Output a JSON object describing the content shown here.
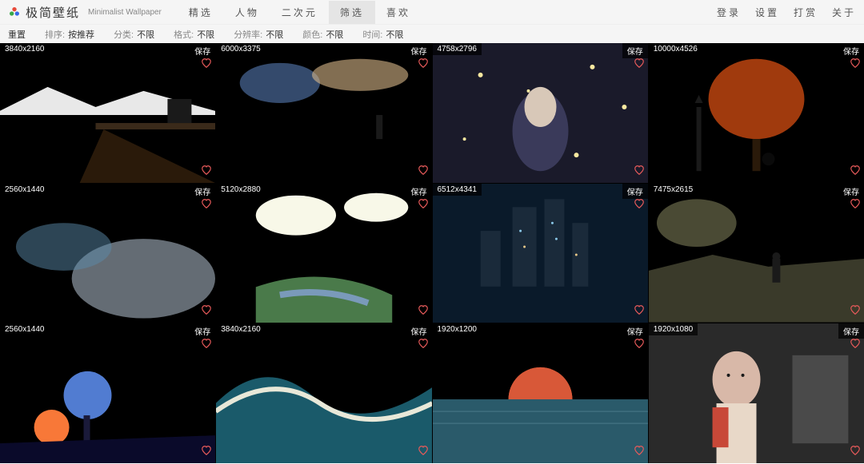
{
  "header": {
    "site_title": "极简壁纸",
    "site_sub": "Minimalist Wallpaper",
    "tabs": [
      {
        "label": "精选"
      },
      {
        "label": "人物"
      },
      {
        "label": "二次元"
      },
      {
        "label": "筛选"
      },
      {
        "label": "喜欢"
      }
    ],
    "active_tab": 3,
    "right_links": [
      {
        "label": "登录"
      },
      {
        "label": "设置"
      },
      {
        "label": "打赏"
      },
      {
        "label": "关于"
      }
    ]
  },
  "filters": [
    {
      "label": "重置",
      "value": ""
    },
    {
      "label": "排序:",
      "value": "按推荐"
    },
    {
      "label": "分类:",
      "value": "不限"
    },
    {
      "label": "格式:",
      "value": "不限"
    },
    {
      "label": "分辨率:",
      "value": "不限"
    },
    {
      "label": "颜色:",
      "value": "不限"
    },
    {
      "label": "时间:",
      "value": "不限"
    }
  ],
  "save_label": "保存",
  "items": [
    {
      "res": "3840x2160"
    },
    {
      "res": "6000x3375"
    },
    {
      "res": "4758x2796"
    },
    {
      "res": "10000x4526"
    },
    {
      "res": "2560x1440"
    },
    {
      "res": "5120x2880"
    },
    {
      "res": "6512x4341"
    },
    {
      "res": "7475x2615"
    },
    {
      "res": "2560x1440"
    },
    {
      "res": "3840x2160"
    },
    {
      "res": "1920x1200"
    },
    {
      "res": "1920x1080"
    }
  ],
  "thumb_svgs": [
    "<svg xmlns='http://www.w3.org/2000/svg' viewBox='0 0 270 175'><defs><linearGradient id='g0' x1='0' y1='0' x2='0' y2='1'><stop offset='0' stop-color='#0a1a3a'/><stop offset='0.45' stop-color='#1a4a7a'/><stop offset='0.46' stop-color='#5a7a9a'/><stop offset='1' stop-color='#0a2a4a'/></linearGradient></defs><rect width='270' height='175' fill='url(%23g0)'/><polygon points='0,85 60,55 120,80 180,60 270,85 270,90 0,90' fill='#e8e8e8'/><rect x='120' y='100' width='150' height='8' fill='#3a2a1a'/><polygon points='130,108 270,175 100,175' fill='#2a1a0a'/><rect x='210' y='70' width='30' height='30' fill='#1a1a1a'/></svg>",
    "<svg xmlns='http://www.w3.org/2000/svg' viewBox='0 0 270 175'><defs><linearGradient id='g1' x1='0' y1='0' x2='0' y2='1'><stop offset='0' stop-color='#2a4a7a'/><stop offset='0.4' stop-color='#e8a860'/><stop offset='0.6' stop-color='#f8d8a0'/><stop offset='0.65' stop-color='#6a8aaa'/><stop offset='1' stop-color='#2a3a4a'/></linearGradient></defs><rect width='270' height='175' fill='url(%23g1)'/><ellipse cx='80' cy='50' rx='50' ry='25' fill='#4a6a9a' opacity='0.7'/><ellipse cx='180' cy='40' rx='60' ry='20' fill='#d8b888' opacity='0.6'/><rect x='200' y='90' width='8' height='30' fill='#1a1a1a'/></svg>",
    "<svg xmlns='http://www.w3.org/2000/svg' viewBox='0 0 270 175'><rect width='270' height='175' fill='#1a1a2a'/><circle cx='60' cy='40' r='3' fill='#f8e8a0'/><circle cx='200' cy='30' r='3' fill='#f8e8a0'/><circle cx='120' cy='60' r='2' fill='#f8e8a0'/><circle cx='240' cy='80' r='3' fill='#f8e8a0'/><circle cx='40' cy='120' r='2' fill='#f8e8a0'/><circle cx='180' cy='140' r='3' fill='#f8e8a0'/><ellipse cx='135' cy='110' rx='35' ry='50' fill='#3a3a5a'/><ellipse cx='135' cy='80' rx='20' ry='25' fill='#d8c8b8'/></svg>",
    "<svg xmlns='http://www.w3.org/2000/svg' viewBox='0 0 270 175'><defs><radialGradient id='g3' cx='0.5' cy='0.4'><stop offset='0' stop-color='#f8d850'/><stop offset='0.4' stop-color='#e86820'/><stop offset='1' stop-color='#1a0a0a'/></radialGradient></defs><rect width='270' height='175' fill='url(%23g3)'/><ellipse cx='135' cy='70' rx='60' ry='50' fill='#c84810' opacity='0.8'/><rect x='130' y='120' width='10' height='40' fill='#2a1a0a'/><rect x='60' y='80' width='6' height='80' fill='#1a1a1a'/><polygon points='58,75 68,75 63,65' fill='#1a1a1a'/><circle cx='150' cy='145' r='8' fill='#0a0a0a'/></svg>",
    "<svg xmlns='http://www.w3.org/2000/svg' viewBox='0 0 270 175'><defs><linearGradient id='g4' x1='0' y1='0' x2='1' y2='1'><stop offset='0' stop-color='#0a2a4a'/><stop offset='0.5' stop-color='#2a6a9a'/><stop offset='1' stop-color='#8ababb'/></linearGradient></defs><rect width='270' height='175' fill='url(%23g4)'/><ellipse cx='180' cy='120' rx='90' ry='50' fill='#c8d8e8' opacity='0.5'/><ellipse cx='80' cy='80' rx='60' ry='30' fill='#5a8aaa' opacity='0.5'/></svg>",
    "<svg xmlns='http://www.w3.org/2000/svg' viewBox='0 0 270 175'><defs><linearGradient id='g5' x1='0' y1='0' x2='0' y2='1'><stop offset='0' stop-color='#7ab8e8'/><stop offset='0.5' stop-color='#b8d8e8'/><stop offset='0.55' stop-color='#6a9a5a'/><stop offset='1' stop-color='#2a5a3a'/></linearGradient></defs><rect width='270' height='175' fill='url(%23g5)'/><ellipse cx='100' cy='40' rx='50' ry='25' fill='#f8f8e8'/><ellipse cx='200' cy='30' rx='40' ry='18' fill='#f8f8e8'/><path d='M 50 130 Q 135 100 220 140 L 220 175 L 50 175 Z' fill='#4a7a4a'/><path d='M 80 140 Q 135 130 190 150' stroke='#7a9aba' stroke-width='8' fill='none'/></svg>",
    "<svg xmlns='http://www.w3.org/2000/svg' viewBox='0 0 270 175'><rect width='270' height='175' fill='#0a1a2a'/><rect x='100' y='30' width='30' height='100' fill='#1a2a3a'/><rect x='140' y='20' width='25' height='110' fill='#1a2a3a'/><rect x='175' y='50' width='20' height='80' fill='#1a2a3a'/><rect x='60' y='60' width='25' height='70' fill='#1a2a3a'/><circle cx='110' cy='60' r='1.5' fill='#8ac8e8'/><circle cx='150' cy='50' r='1.5' fill='#8ac8e8'/><circle cx='115' cy='80' r='1.5' fill='#e8c888'/><circle cx='155' cy='70' r='1.5' fill='#8ac8e8'/><circle cx='180' cy='90' r='1.5' fill='#e8c888'/></svg>",
    "<svg xmlns='http://www.w3.org/2000/svg' viewBox='0 0 270 175'><defs><linearGradient id='g7' x1='0' y1='0' x2='0' y2='1'><stop offset='0' stop-color='#8a8a6a'/><stop offset='0.4' stop-color='#c8b888'/><stop offset='0.6' stop-color='#5a5a3a'/><stop offset='1' stop-color='#2a2a1a'/></linearGradient></defs><rect width='270' height='175' fill='url(%23g7)'/><ellipse cx='60' cy='50' rx='50' ry='30' fill='#6a6a4a' opacity='0.7'/><polygon points='0,110 80,90 150,105 270,95 270,175 0,175' fill='#3a3a2a'/><rect x='155' y='95' width='10' height='30' fill='#1a1a1a'/><circle cx='160' cy='92' r='5' fill='#1a1a1a'/></svg>",
    "<svg xmlns='http://www.w3.org/2000/svg' viewBox='0 0 270 175'><defs><linearGradient id='g8' x1='0' y1='0' x2='0' y2='1'><stop offset='0' stop-color='#1a2a5a'/><stop offset='0.6' stop-color='#4a3a7a'/><stop offset='0.85' stop-color='#e85a4a'/><stop offset='1' stop-color='#0a1a3a'/></linearGradient></defs><rect width='270' height='175' fill='url(%23g8)'/><circle cx='65' cy='130' r='22' fill='#f87838'/><circle cx='110' cy='90' r='30' fill='#5a8ae8' opacity='0.9'/><rect x='105' y='115' width='8' height='50' fill='#1a1a3a'/><polygon points='0,150 270,140 270,175 0,175' fill='#0a0a2a'/></svg>",
    "<svg xmlns='http://www.w3.org/2000/svg' viewBox='0 0 270 175'><defs><linearGradient id='g9' x1='0' y1='0' x2='0' y2='1'><stop offset='0' stop-color='#f89868'/><stop offset='0.5' stop-color='#e8b888'/><stop offset='1' stop-color='#2a6a7a'/></linearGradient></defs><rect width='270' height='175' fill='url(%23g9)'/><path d='M 0 100 Q 60 40 120 90 Q 180 140 270 80 L 270 175 L 0 175 Z' fill='#1a5a6a'/><path d='M 0 110 Q 70 60 130 100 Q 190 140 270 100' stroke='#e8e8d8' stroke-width='6' fill='none'/></svg>",
    "<svg xmlns='http://www.w3.org/2000/svg' viewBox='0 0 270 175'><defs><linearGradient id='g10' x1='0' y1='0' x2='0' y2='1'><stop offset='0' stop-color='#d8d8c8'/><stop offset='0.5' stop-color='#e8c8a8'/><stop offset='0.6' stop-color='#3a6a7a'/><stop offset='1' stop-color='#1a3a4a'/></linearGradient></defs><rect width='270' height='175' fill='url(%23g10)'/><circle cx='135' cy='95' r='40' fill='#d85838'/><rect x='0' y='95' width='270' height='80' fill='#2a5a6a'/><path d='M 95 95 A 40 40 0 0 1 175 95' fill='#d85838'/><line x1='0' y1='110' x2='270' y2='110' stroke='#4a7a8a' stroke-width='1'/><line x1='0' y1='125' x2='270' y2='125' stroke='#4a7a8a' stroke-width='1'/></svg>",
    "<svg xmlns='http://www.w3.org/2000/svg' viewBox='0 0 270 175'><rect width='270' height='175' fill='#2a2a2a'/><rect x='180' y='40' width='70' height='110' fill='#4a4a4a'/><ellipse cx='110' cy='70' rx='30' ry='35' fill='#d8b8a8'/><rect x='85' y='100' width='50' height='75' fill='#e8d8c8'/><rect x='80' y='105' width='20' height='50' fill='#c84838'/><circle cx='100' cy='65' r='2' fill='#1a1a1a'/><circle cx='118' cy='65' r='2' fill='#1a1a1a'/></svg>"
  ]
}
